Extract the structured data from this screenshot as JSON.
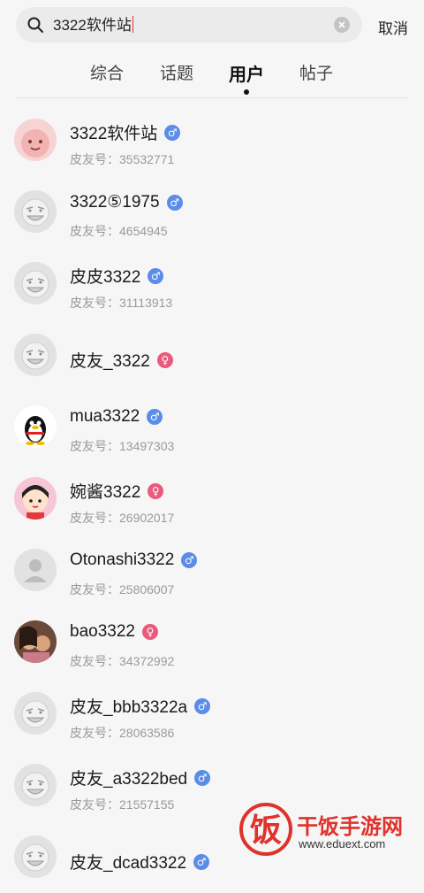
{
  "search": {
    "query": "3322软件站",
    "cancel_label": "取消"
  },
  "tabs": [
    {
      "label": "综合"
    },
    {
      "label": "话题"
    },
    {
      "label": "用户"
    },
    {
      "label": "帖子"
    }
  ],
  "active_tab": "用户",
  "users": [
    {
      "name": "3322软件站",
      "gender": "male",
      "gender_symbol": "♂",
      "id_text": "皮友号：35532771"
    },
    {
      "name": "3322⑤1975",
      "gender": "male",
      "gender_symbol": "♂",
      "id_text": "皮友号：4654945"
    },
    {
      "name": "皮皮3322",
      "gender": "male",
      "gender_symbol": "♂",
      "id_text": "皮友号：31113913"
    },
    {
      "name": "皮友_3322",
      "gender": "female",
      "gender_symbol": "♀",
      "id_text": ""
    },
    {
      "name": "mua3322",
      "gender": "male",
      "gender_symbol": "♂",
      "id_text": "皮友号：13497303"
    },
    {
      "name": "婉酱3322",
      "gender": "female",
      "gender_symbol": "♀",
      "id_text": "皮友号：26902017"
    },
    {
      "name": "Otonashi3322",
      "gender": "male",
      "gender_symbol": "♂",
      "id_text": "皮友号：25806007"
    },
    {
      "name": "bao3322",
      "gender": "female",
      "gender_symbol": "♀",
      "id_text": "皮友号：34372992"
    },
    {
      "name": "皮友_bbb3322a",
      "gender": "male",
      "gender_symbol": "♂",
      "id_text": "皮友号：28063586"
    },
    {
      "name": "皮友_a3322bed",
      "gender": "male",
      "gender_symbol": "♂",
      "id_text": "皮友号：21557155"
    },
    {
      "name": "皮友_dcad3322",
      "gender": "male",
      "gender_symbol": "♂",
      "id_text": ""
    }
  ],
  "watermark": {
    "title": "干饭手游网",
    "url": "www.eduext.com",
    "logo_char": "饭"
  },
  "colors": {
    "male": "#5b8de8",
    "female": "#ea5a7e",
    "watermark": "#e0322c"
  }
}
